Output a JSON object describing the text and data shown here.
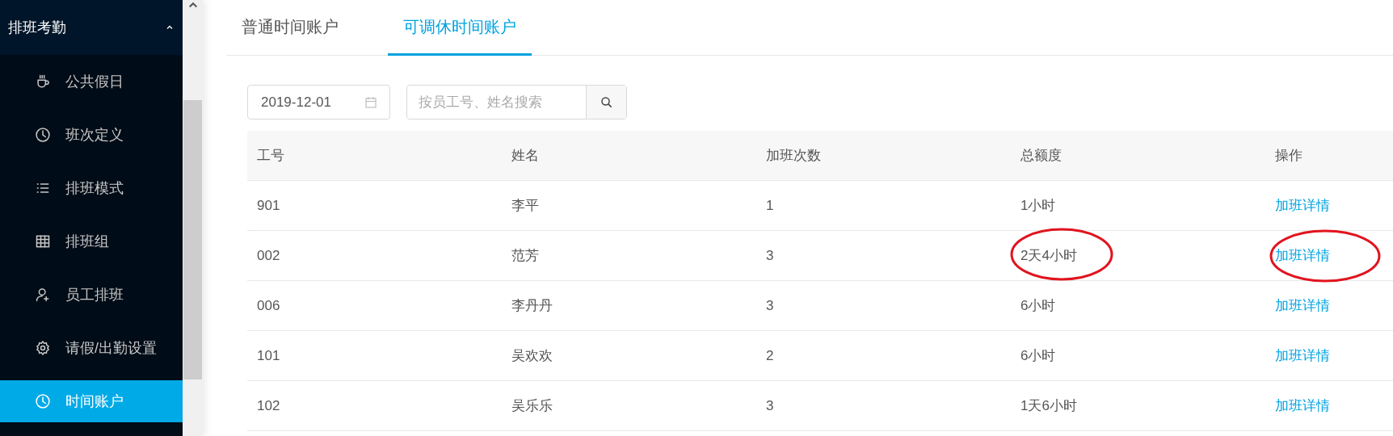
{
  "sidebar": {
    "group": {
      "label": "排班考勤",
      "expanded": true
    },
    "items": [
      {
        "label": "公共假日",
        "selected": false
      },
      {
        "label": "班次定义",
        "selected": false
      },
      {
        "label": "排班模式",
        "selected": false
      },
      {
        "label": "排班组",
        "selected": false
      },
      {
        "label": "员工排班",
        "selected": false
      },
      {
        "label": "请假/出勤设置",
        "selected": false
      },
      {
        "label": "时间账户",
        "selected": true
      }
    ]
  },
  "tabs": [
    {
      "label": "普通时间账户",
      "selected": false
    },
    {
      "label": "可调休时间账户",
      "selected": true
    }
  ],
  "filters": {
    "date": "2019-12-01",
    "search": {
      "placeholder": "按员工号、姓名搜索"
    }
  },
  "table": {
    "columns": [
      "工号",
      "姓名",
      "加班次数",
      "总额度",
      "操作"
    ],
    "rows": [
      {
        "cells": [
          "901",
          "李平",
          "1",
          "1小时"
        ],
        "action": "加班详情",
        "circled": false
      },
      {
        "cells": [
          "002",
          "范芳",
          "3",
          "2天4小时"
        ],
        "action": "加班详情",
        "circled": true
      },
      {
        "cells": [
          "006",
          "李丹丹",
          "3",
          "6小时"
        ],
        "action": "加班详情",
        "circled": false
      },
      {
        "cells": [
          "101",
          "吴欢欢",
          "2",
          "6小时"
        ],
        "action": "加班详情",
        "circled": false
      },
      {
        "cells": [
          "102",
          "吴乐乐",
          "3",
          "1天6小时"
        ],
        "action": "加班详情",
        "circled": false
      }
    ]
  }
}
